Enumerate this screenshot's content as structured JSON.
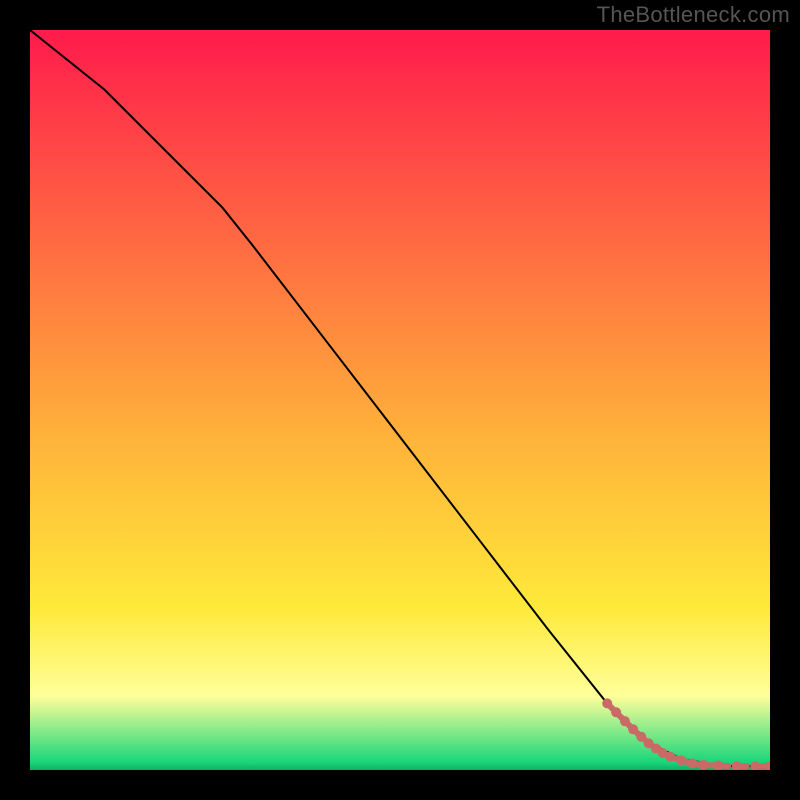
{
  "watermark": "TheBottleneck.com",
  "chart_data": {
    "type": "line",
    "title": "",
    "xlabel": "",
    "ylabel": "",
    "xlim": [
      0,
      100
    ],
    "ylim": [
      0,
      100
    ],
    "background_gradient": {
      "top_color": "#ff1b4b",
      "ylw_color": "#ffe93a",
      "pale_band": "#ffff9a",
      "bottom_color": "#18d67a"
    },
    "series": [
      {
        "name": "curve",
        "stroke": "#000000",
        "stroke_width": 2,
        "x": [
          0,
          10,
          20,
          26,
          30,
          40,
          50,
          60,
          70,
          78,
          83,
          88,
          92,
          95,
          100
        ],
        "y": [
          100,
          92,
          82,
          76,
          71,
          58,
          45,
          32,
          19,
          9,
          4,
          1.5,
          0.8,
          0.5,
          0.5
        ]
      },
      {
        "name": "markers",
        "stroke": "#c96a66",
        "marker_radius": 5,
        "points": [
          {
            "x": 78.0,
            "y": 9.0
          },
          {
            "x": 79.2,
            "y": 7.8
          },
          {
            "x": 80.4,
            "y": 6.6
          },
          {
            "x": 81.5,
            "y": 5.5
          },
          {
            "x": 82.6,
            "y": 4.5
          },
          {
            "x": 83.6,
            "y": 3.6
          },
          {
            "x": 84.6,
            "y": 2.9
          },
          {
            "x": 85.5,
            "y": 2.3
          },
          {
            "x": 86.5,
            "y": 1.8
          },
          {
            "x": 88.0,
            "y": 1.3
          },
          {
            "x": 89.5,
            "y": 0.9
          },
          {
            "x": 91.0,
            "y": 0.7
          },
          {
            "x": 93.0,
            "y": 0.6
          },
          {
            "x": 95.5,
            "y": 0.5
          },
          {
            "x": 98.0,
            "y": 0.5
          },
          {
            "x": 100.0,
            "y": 0.5
          }
        ]
      }
    ]
  }
}
